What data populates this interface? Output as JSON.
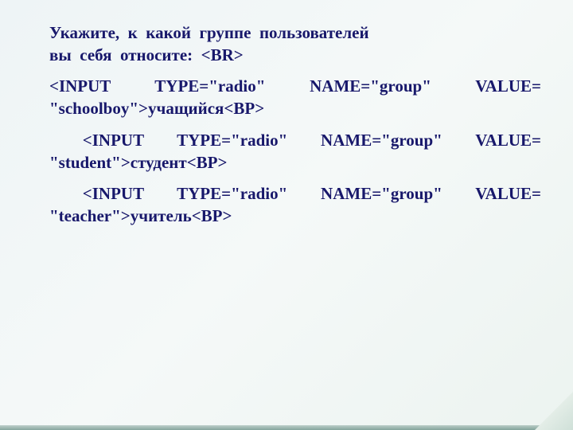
{
  "slide": {
    "intro_line1": "Укажите,   к   какой     группе пользователей",
    "intro_line2": "вы   себя   относите:    <BR>",
    "opt1_line1": "<INPUT    TYPE=\"radio\" NAME=\"group\"    VALUE= \"schoolboy\">учащийся<BP>",
    "opt2_line1": "<INPUT    TYPE=\"radio\" NAME=\"group\"    VALUE= \"student\">студент<BP>",
    "opt3_line1": "<INPUT    TYPE=\"radio\" NAME=\"group\"    VALUE= \"teacher\">учитель<BP>"
  }
}
